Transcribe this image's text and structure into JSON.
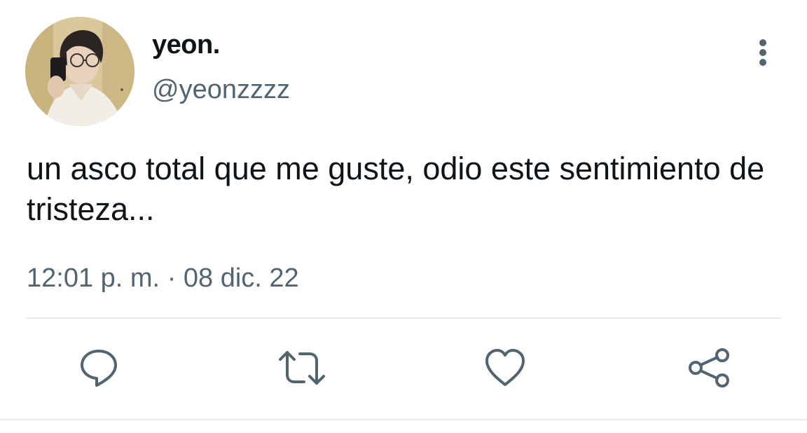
{
  "user": {
    "display_name": "yeon.",
    "handle": "@yeonzzzz",
    "avatar_icon": "profile-photo"
  },
  "tweet": {
    "text": "un asco total que me guste, odio este sentimiento de tristeza...",
    "time": "12:01 p. m.",
    "separator": "·",
    "date": "08 dic. 22"
  },
  "actions": [
    {
      "name": "reply",
      "icon": "speech-bubble-icon"
    },
    {
      "name": "retweet",
      "icon": "retweet-icon"
    },
    {
      "name": "like",
      "icon": "heart-icon"
    },
    {
      "name": "share",
      "icon": "share-icon"
    }
  ],
  "colors": {
    "text_primary": "#0f1419",
    "text_secondary": "#536471",
    "icon": "#536471",
    "divider": "#e6ecf0"
  }
}
